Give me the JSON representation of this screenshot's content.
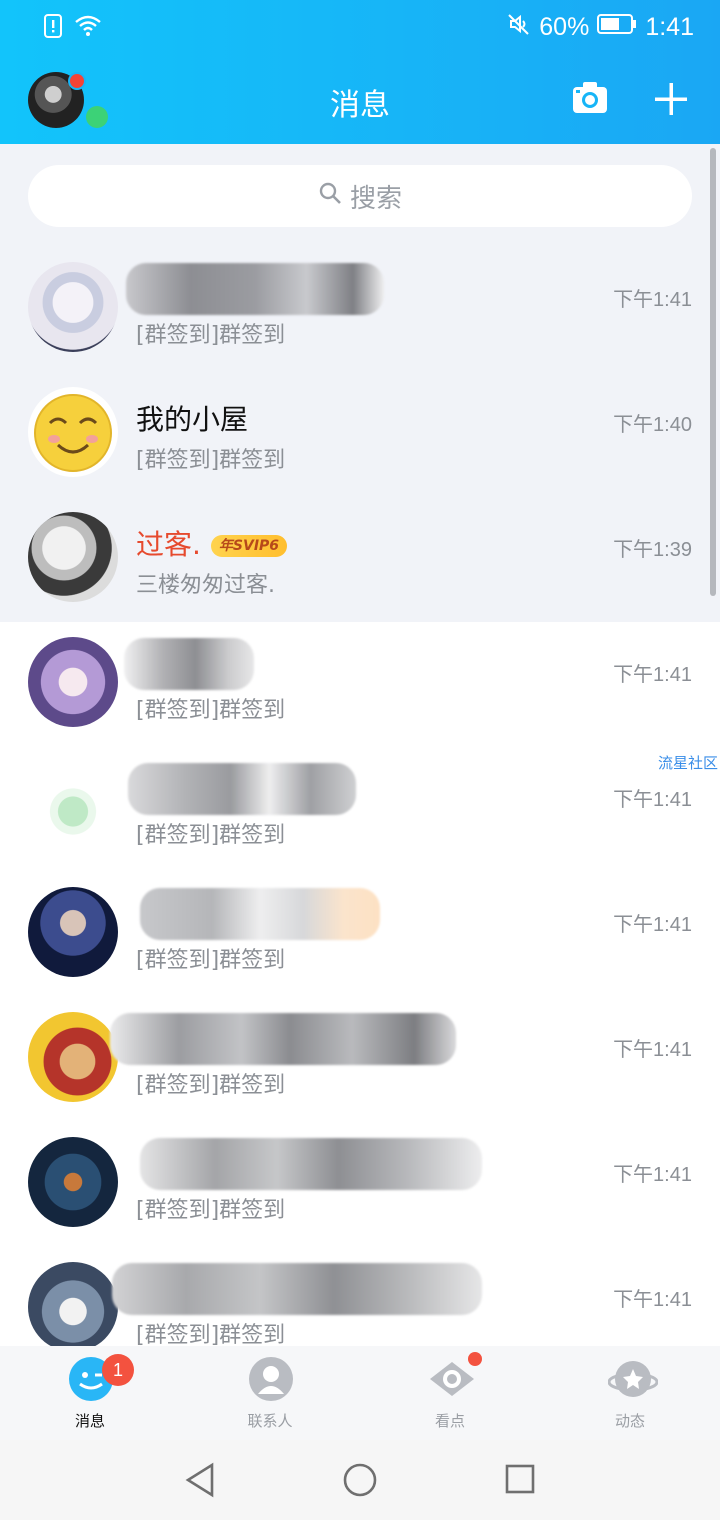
{
  "status_bar": {
    "battery_percent": "60%",
    "time": "1:41",
    "icons": [
      "sim-alert-icon",
      "wifi-icon",
      "mute-icon",
      "battery-icon"
    ]
  },
  "header": {
    "title": "消息",
    "icons": [
      "camera-icon",
      "plus-icon"
    ],
    "accent_color": "#17b5f7"
  },
  "search": {
    "placeholder": "搜索"
  },
  "conversations": [
    {
      "name": "",
      "preview": "[群签到]群签到",
      "time": "下午1:41",
      "pinned": true
    },
    {
      "name": "我的小屋",
      "preview": "[群签到]群签到",
      "time": "下午1:40",
      "pinned": true
    },
    {
      "name": "过客.",
      "badge": "年SVIP6",
      "preview": "三楼匆匆过客.",
      "time": "下午1:39",
      "pinned": true,
      "name_color": "#e64a2e"
    },
    {
      "name": "",
      "preview": "[群签到]群签到",
      "time": "下午1:41"
    },
    {
      "name": "",
      "preview": "[群签到]群签到",
      "time": "下午1:41"
    },
    {
      "name": "",
      "preview": "[群签到]群签到",
      "time": "下午1:41"
    },
    {
      "name": "",
      "preview": "[群签到]群签到",
      "time": "下午1:41"
    },
    {
      "name": "",
      "preview": "[群签到]群签到",
      "time": "下午1:41"
    },
    {
      "name": "",
      "preview": "[群签到]群签到",
      "time": "下午1:41"
    }
  ],
  "side_tag": "流星社区",
  "tabs": [
    {
      "label": "消息",
      "icon": "message-icon",
      "badge": "1",
      "active": true
    },
    {
      "label": "联系人",
      "icon": "contacts-icon"
    },
    {
      "label": "看点",
      "icon": "eye-icon",
      "dot": true
    },
    {
      "label": "动态",
      "icon": "planet-icon"
    }
  ],
  "system_nav": [
    "back-icon",
    "home-icon",
    "recents-icon"
  ]
}
